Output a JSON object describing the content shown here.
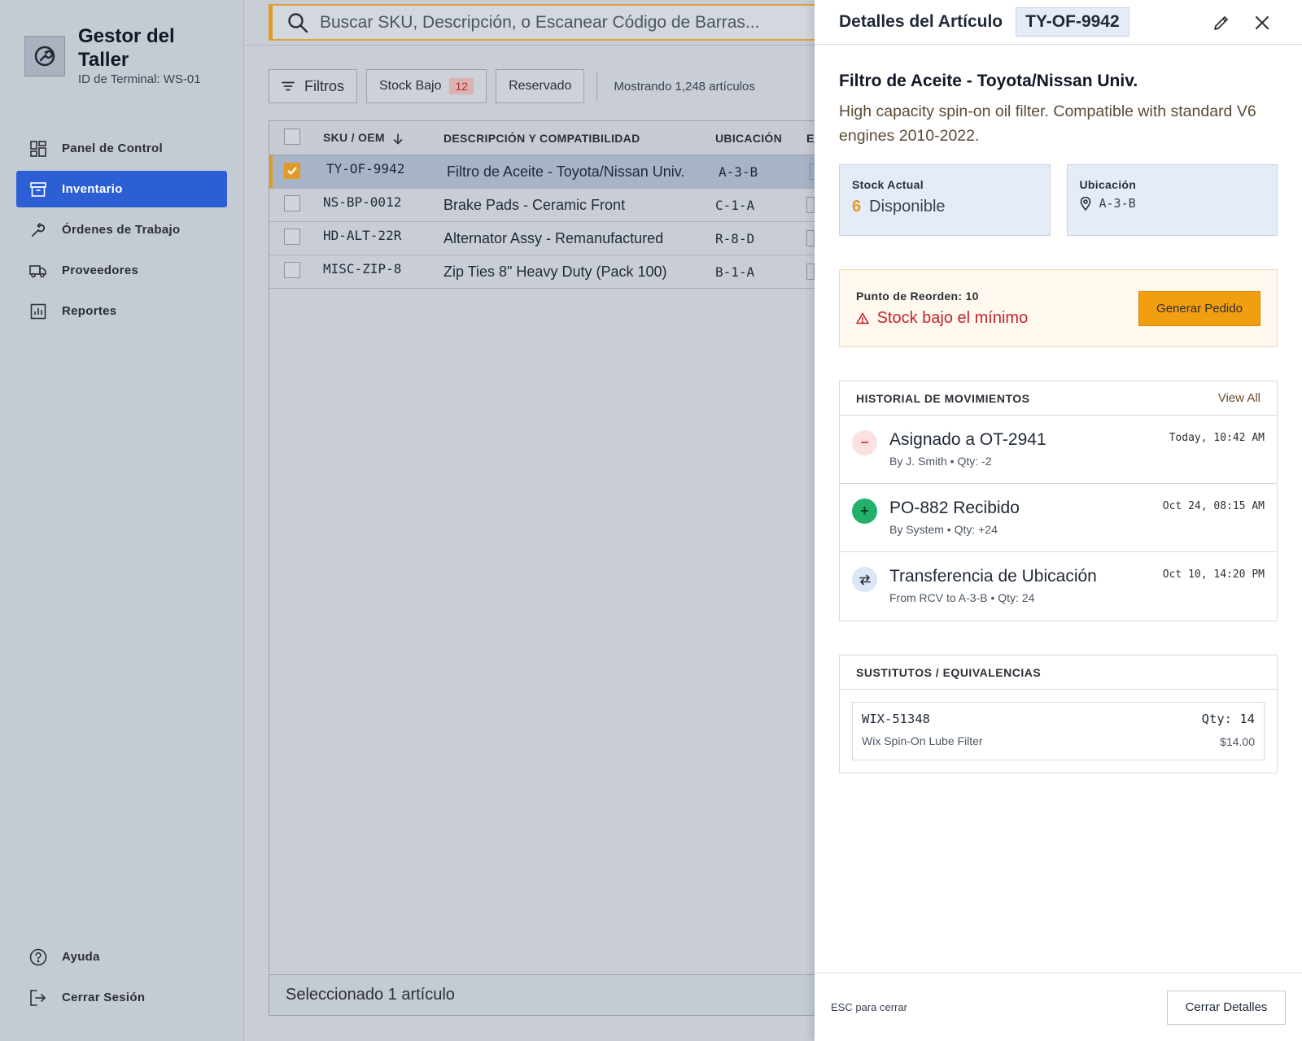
{
  "brand": {
    "title": "Gestor del Taller",
    "terminal": "ID de Terminal: WS-01"
  },
  "nav": {
    "items": [
      {
        "label": "Panel de Control",
        "icon": "dashboard-icon"
      },
      {
        "label": "Inventario",
        "icon": "archive-icon",
        "active": true
      },
      {
        "label": "Órdenes de Trabajo",
        "icon": "wrench-icon"
      },
      {
        "label": "Proveedores",
        "icon": "truck-icon"
      },
      {
        "label": "Reportes",
        "icon": "report-icon"
      }
    ],
    "bottom": [
      {
        "label": "Ayuda",
        "icon": "help-icon"
      },
      {
        "label": "Cerrar Sesión",
        "icon": "logout-icon"
      }
    ]
  },
  "search": {
    "placeholder": "Buscar SKU, Descripción, o Escanear Código de Barras..."
  },
  "filters": {
    "filter_label": "Filtros",
    "low_stock_label": "Stock Bajo",
    "low_stock_count": "12",
    "reserved_label": "Reservado",
    "count_text": "Mostrando 1,248 artículos"
  },
  "table": {
    "headers": {
      "sku": "SKU / OEM",
      "desc": "DESCRIPCIÓN Y COMPATIBILIDAD",
      "loc": "UBICACIÓN",
      "extra": "E"
    },
    "rows": [
      {
        "sku": "TY-OF-9942",
        "desc": "Filtro de Aceite - Toyota/Nissan Univ.",
        "loc": "A-3-B",
        "selected": true
      },
      {
        "sku": "NS-BP-0012",
        "desc": "Brake Pads - Ceramic Front",
        "loc": "C-1-A",
        "selected": false
      },
      {
        "sku": "HD-ALT-22R",
        "desc": "Alternator Assy - Remanufactured",
        "loc": "R-8-D",
        "selected": false
      },
      {
        "sku": "MISC-ZIP-8",
        "desc": "Zip Ties 8\" Heavy Duty (Pack 100)",
        "loc": "B-1-A",
        "selected": false
      }
    ],
    "footer": "Seleccionado 1 artículo"
  },
  "panel": {
    "title": "Detalles del Artículo",
    "sku": "TY-OF-9942",
    "item_name": "Filtro de Aceite - Toyota/Nissan Univ.",
    "item_desc": "High capacity spin-on oil filter. Compatible with standard V6 engines 2010-2022.",
    "stock": {
      "label": "Stock Actual",
      "value": "6",
      "unit": "Disponible"
    },
    "location": {
      "label": "Ubicación",
      "value": "A-3-B"
    },
    "reorder": {
      "label": "Punto de Reorden: 10",
      "warning": "Stock bajo el mínimo",
      "button": "Generar Pedido"
    },
    "history": {
      "title": "HISTORIAL DE MOVIMIENTOS",
      "view_all": "View All",
      "items": [
        {
          "title": "Asignado a OT-2941",
          "sub": "By J. Smith • Qty: -2",
          "time": "Today, 10:42 AM",
          "type": "minus"
        },
        {
          "title": "PO-882 Recibido",
          "sub": "By System • Qty: +24",
          "time": "Oct 24, 08:15 AM",
          "type": "plus"
        },
        {
          "title": "Transferencia de Ubicación",
          "sub": "From RCV to A-3-B • Qty: 24",
          "time": "Oct 10, 14:20 PM",
          "type": "transfer"
        }
      ]
    },
    "substitutes": {
      "title": "SUSTITUTOS / EQUIVALENCIAS",
      "items": [
        {
          "sku": "WIX-51348",
          "qty": "Qty: 14",
          "name": "Wix Spin-On Lube Filter",
          "price": "$14.00"
        }
      ]
    },
    "footer": {
      "esc_hint": "ESC para cerrar",
      "close_button": "Cerrar Detalles"
    }
  },
  "colors": {
    "accent": "#e09a25",
    "nav_active": "#2c5fd4",
    "warning": "#c0262d",
    "order_button": "#f19e10"
  }
}
